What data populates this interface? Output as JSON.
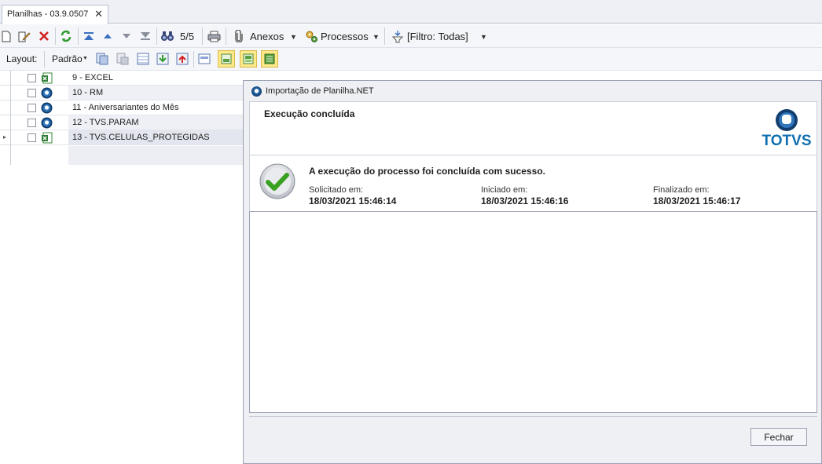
{
  "tab": {
    "title": "Planilhas - 03.9.0507",
    "close_glyph": "✕"
  },
  "toolbar": {
    "counter": "5/5",
    "anexos_label": "Anexos",
    "processos_label": "Processos",
    "filter_label": "[Filtro: Todas]"
  },
  "layout_bar": {
    "layout_label": "Layout:",
    "layout_value": "Padrão"
  },
  "grid": {
    "rows": [
      {
        "label": "9 - EXCEL",
        "icon": "excel-icon"
      },
      {
        "label": "10 - RM",
        "icon": "totvs-globe-icon"
      },
      {
        "label": "11 - Aniversariantes do Mês",
        "icon": "totvs-globe-icon"
      },
      {
        "label": "12 - TVS.PARAM",
        "icon": "totvs-globe-icon"
      },
      {
        "label": "13 - TVS.CELULAS_PROTEGIDAS",
        "icon": "excel-icon"
      }
    ],
    "current_row_marker": "▸"
  },
  "dialog": {
    "title": "Importação de Planilha.NET",
    "header": "Execução concluída",
    "logo_text": "TOTVS",
    "message": "A execução do processo foi concluída com sucesso.",
    "requested_label": "Solicitado em:",
    "requested_value": "18/03/2021 15:46:14",
    "started_label": "Iniciado em:",
    "started_value": "18/03/2021 15:46:16",
    "finished_label": "Finalizado em:",
    "finished_value": "18/03/2021 15:46:17",
    "close_button": "Fechar"
  },
  "colors": {
    "brand": "#0f6fb0",
    "highlight": "#fde98a",
    "success": "#3aa021"
  }
}
